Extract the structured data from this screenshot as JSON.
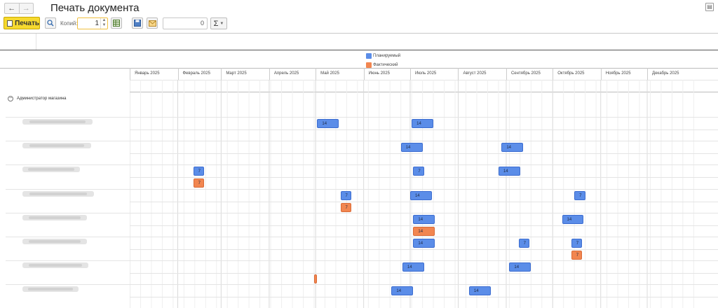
{
  "window": {
    "title": "Печать документа",
    "back_icon": "←",
    "forward_icon": "→"
  },
  "toolbar": {
    "print_label": "Печать",
    "copies_label": "Копий:",
    "copies_value": "1",
    "number_field_value": "0",
    "sum_icon": "Σ"
  },
  "colors": {
    "planned": "#5b8de8",
    "actual": "#f28650",
    "print_button": "#f6d92f"
  },
  "legend": [
    {
      "label": "Планируемый",
      "kind": "planned"
    },
    {
      "label": "Фактический",
      "kind": "actual"
    }
  ],
  "months": [
    "Январь 2025",
    "Февраль 2025",
    "Март 2025",
    "Апрель 2025",
    "Май 2025",
    "Июнь 2025",
    "Июль 2025",
    "Август 2025",
    "Сентябрь 2025",
    "Октябрь 2025",
    "Ноябрь 2025",
    "Декабрь 2025"
  ],
  "group": {
    "label": "Администратор магазина"
  },
  "employees": [
    {
      "planned": [
        {
          "start": "2025-05-02",
          "end": "2025-05-15",
          "label": "14"
        },
        {
          "start": "2025-07-02",
          "end": "2025-07-15",
          "label": "14"
        }
      ],
      "actual": []
    },
    {
      "planned": [
        {
          "start": "2025-06-25",
          "end": "2025-07-08",
          "label": "14"
        },
        {
          "start": "2025-08-29",
          "end": "2025-09-11",
          "label": "14"
        }
      ],
      "actual": []
    },
    {
      "planned": [
        {
          "start": "2025-02-11",
          "end": "2025-02-17",
          "label": "7"
        },
        {
          "start": "2025-07-03",
          "end": "2025-07-09",
          "label": "7"
        },
        {
          "start": "2025-08-27",
          "end": "2025-09-09",
          "label": "14"
        }
      ],
      "actual": [
        {
          "start": "2025-02-11",
          "end": "2025-02-17",
          "label": "7"
        }
      ]
    },
    {
      "planned": [
        {
          "start": "2025-05-17",
          "end": "2025-05-23",
          "label": "7"
        },
        {
          "start": "2025-07-01",
          "end": "2025-07-14",
          "label": "14"
        },
        {
          "start": "2025-10-15",
          "end": "2025-10-21",
          "label": "7"
        }
      ],
      "actual": [
        {
          "start": "2025-05-17",
          "end": "2025-05-23",
          "label": "7"
        }
      ]
    },
    {
      "planned": [
        {
          "start": "2025-07-03",
          "end": "2025-07-16",
          "label": "14"
        },
        {
          "start": "2025-10-07",
          "end": "2025-10-20",
          "label": "14"
        }
      ],
      "actual": [
        {
          "start": "2025-07-03",
          "end": "2025-07-16",
          "label": "14"
        }
      ]
    },
    {
      "planned": [
        {
          "start": "2025-07-03",
          "end": "2025-07-16",
          "label": "14"
        },
        {
          "start": "2025-09-09",
          "end": "2025-09-15",
          "label": "7"
        },
        {
          "start": "2025-10-13",
          "end": "2025-10-19",
          "label": "7"
        }
      ],
      "actual": [
        {
          "start": "2025-10-13",
          "end": "2025-10-19",
          "label": "7"
        }
      ]
    },
    {
      "planned": [
        {
          "start": "2025-06-26",
          "end": "2025-07-09",
          "label": "14"
        },
        {
          "start": "2025-09-03",
          "end": "2025-09-16",
          "label": "14"
        }
      ],
      "actual": [
        {
          "start": "2025-04-30",
          "end": "2025-05-01",
          "label": ""
        }
      ]
    },
    {
      "planned": [
        {
          "start": "2025-06-19",
          "end": "2025-07-02",
          "label": "14"
        },
        {
          "start": "2025-08-08",
          "end": "2025-08-21",
          "label": "14"
        }
      ],
      "actual": []
    }
  ]
}
